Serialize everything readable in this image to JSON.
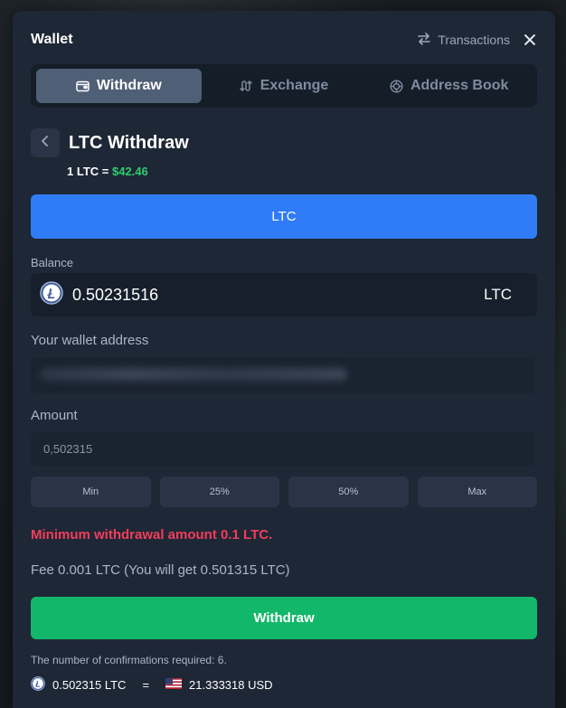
{
  "header": {
    "title": "Wallet",
    "transactions_label": "Transactions"
  },
  "tabs": [
    {
      "label": "Withdraw",
      "active": true,
      "icon": "wallet-icon"
    },
    {
      "label": "Exchange",
      "active": false,
      "icon": "exchange-icon"
    },
    {
      "label": "Address Book",
      "active": false,
      "icon": "address-book-icon"
    }
  ],
  "withdraw": {
    "title": "LTC Withdraw",
    "rate_prefix": "1 LTC =",
    "rate_price": "$42.46",
    "coin_selected": "LTC",
    "balance_label": "Balance",
    "balance_value": "0.50231516",
    "balance_currency": "LTC",
    "address_label": "Your wallet address",
    "amount_label": "Amount",
    "amount_value": "0,502315",
    "quick_buttons": [
      "Min",
      "25%",
      "50%",
      "Max"
    ],
    "error_message": "Minimum withdrawal amount 0.1 LTC.",
    "fee_text": "Fee 0.001 LTC (You will get 0.501315 LTC)",
    "submit_label": "Withdraw",
    "confirmations_text": "The number of confirmations required: 6.",
    "summary_ltc": "0.502315 LTC",
    "summary_eq": "=",
    "summary_usd": "21.333318 USD"
  },
  "colors": {
    "accent_blue": "#2f7cf6",
    "success_green": "#12b76a",
    "error_red": "#f23d5c",
    "price_green": "#2ecc71"
  }
}
